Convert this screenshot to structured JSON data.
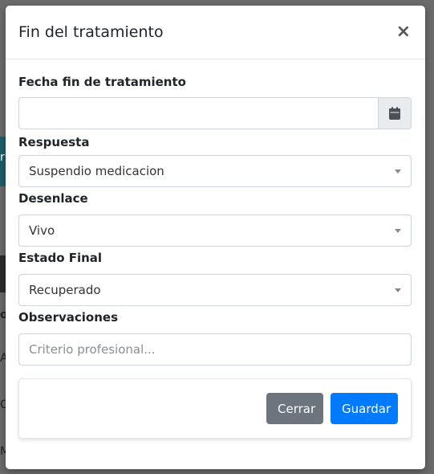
{
  "modal": {
    "title": "Fin del tratamiento",
    "close_symbol": "×"
  },
  "fields": {
    "fecha": {
      "label": "Fecha fin de tratamiento",
      "value": "",
      "icon": "calendar-icon"
    },
    "respuesta": {
      "label": "Respuesta",
      "selected": "Suspendio medicacion"
    },
    "desenlace": {
      "label": "Desenlace",
      "selected": "Vivo"
    },
    "estado_final": {
      "label": "Estado Final",
      "selected": "Recuperado"
    },
    "observaciones": {
      "label": "Observaciones",
      "placeholder": "Criterio profesional..."
    }
  },
  "footer": {
    "cerrar_label": "Cerrar",
    "guardar_label": "Guardar"
  },
  "colors": {
    "primary": "#007bff",
    "secondary": "#6c757d",
    "border": "#ced4da",
    "addon_bg": "#e9ecef"
  },
  "background_fragments": [
    "r",
    "o",
    "A",
    "C",
    "M"
  ]
}
